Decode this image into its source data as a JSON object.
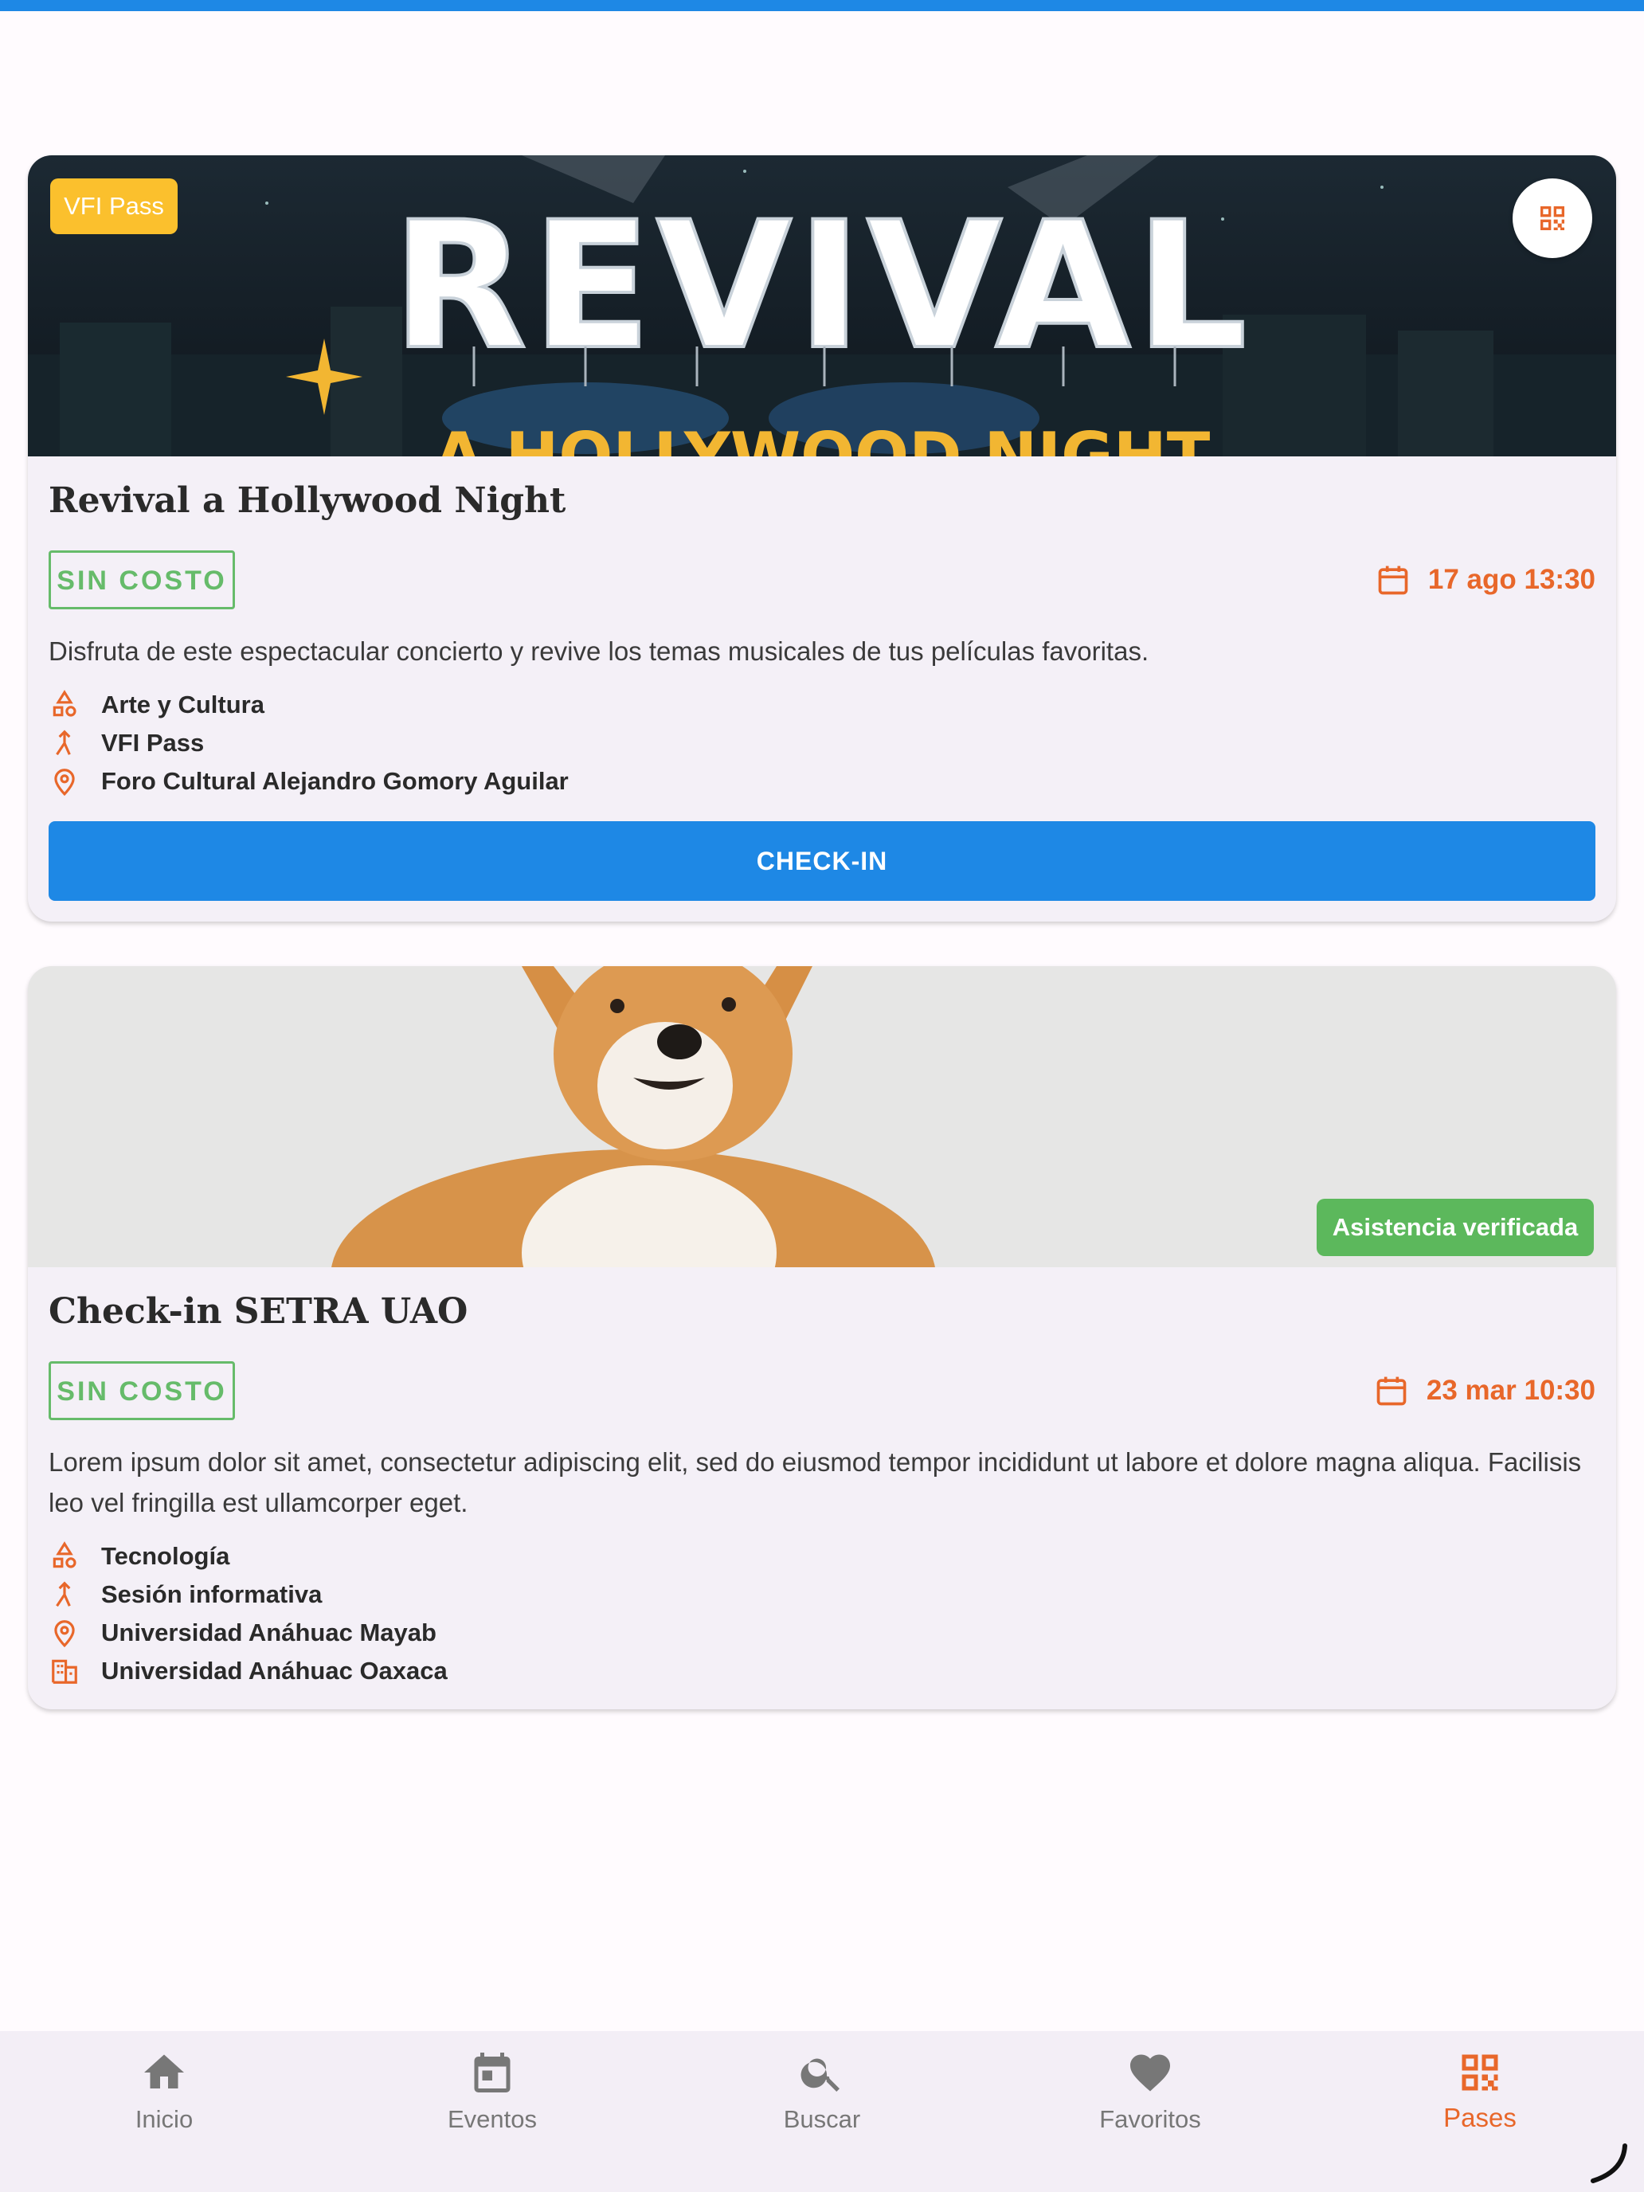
{
  "colors": {
    "primary_blue": "#1e88e5",
    "accent_orange": "#e8672a",
    "pass_yellow": "#fbc02d",
    "free_green": "#66bb6a",
    "verified_green": "#5cb85c",
    "card_bg": "#f4f0f7"
  },
  "events": [
    {
      "banner_badge": "VFI Pass",
      "banner_art_text": "REVIVAL",
      "banner_art_subtext": "A HOLLYWOOD NIGHT",
      "qr_icon": "qr-code-icon",
      "title": "Revival a Hollywood Night",
      "price": "SIN COSTO",
      "date": "17 ago 13:30",
      "description": "Disfruta de este espectacular concierto y revive los temas musicales de tus películas favoritas.",
      "category": "Arte y Cultura",
      "type": "VFI Pass",
      "location": "Foro Cultural Alejandro Gomory Aguilar",
      "action_label": "CHECK-IN"
    },
    {
      "status_badge": "Asistencia verificada",
      "title": "Check-in SETRA UAO",
      "price": "SIN COSTO",
      "date": "23 mar 10:30",
      "description": "Lorem ipsum dolor sit amet, consectetur adipiscing elit, sed do eiusmod tempor incididunt ut labore et dolore magna aliqua. Facilisis leo vel fringilla est ullamcorper eget.",
      "category": "Tecnología",
      "type": "Sesión informativa",
      "location": "Universidad Anáhuac Mayab",
      "campus": "Universidad Anáhuac Oaxaca"
    }
  ],
  "nav": {
    "items": [
      {
        "label": "Inicio",
        "icon": "home-icon"
      },
      {
        "label": "Eventos",
        "icon": "calendar-icon"
      },
      {
        "label": "Buscar",
        "icon": "search-icon"
      },
      {
        "label": "Favoritos",
        "icon": "heart-icon"
      },
      {
        "label": "Pases",
        "icon": "qr-code-icon"
      }
    ],
    "active": "Pases"
  }
}
